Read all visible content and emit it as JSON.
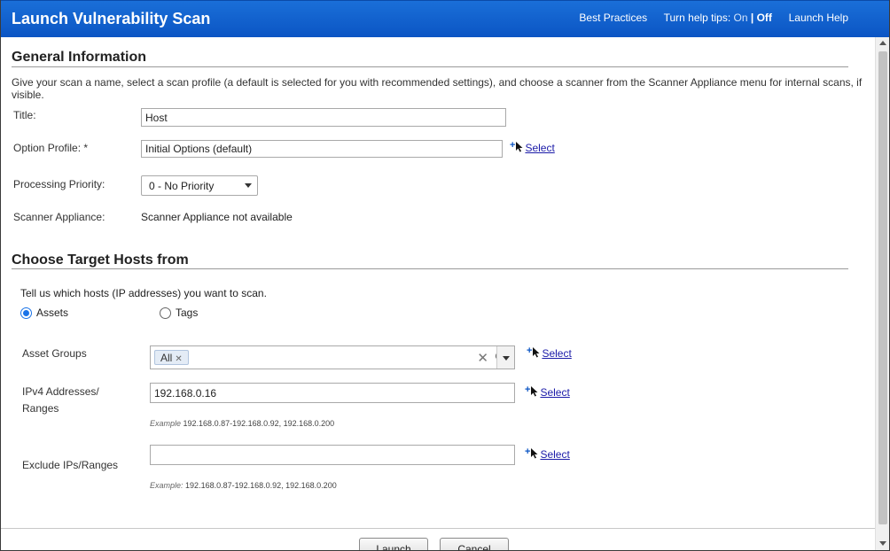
{
  "header": {
    "title": "Launch Vulnerability Scan",
    "best_practices": "Best Practices",
    "help_tips_label": "Turn help tips:",
    "help_tips_on": "On",
    "help_tips_sep": "|",
    "help_tips_off": "Off",
    "launch_help": "Launch Help"
  },
  "general": {
    "section_title": "General Information",
    "description": "Give your scan a name, select a scan profile (a default is selected for you with recommended settings), and choose a scanner from the Scanner Appliance menu for internal scans, if visible.",
    "title_label": "Title:",
    "title_value": "Host",
    "option_profile_label": "Option Profile: *",
    "option_profile_value": "Initial Options (default)",
    "option_profile_select": "Select",
    "priority_label": "Processing Priority:",
    "priority_value": "0 - No Priority",
    "scanner_label": "Scanner Appliance:",
    "scanner_value": "Scanner Appliance not available"
  },
  "targets": {
    "section_title": "Choose Target Hosts from",
    "instruction": "Tell us which hosts (IP addresses) you want to scan.",
    "radio_assets": "Assets",
    "radio_tags": "Tags",
    "asset_groups_label": "Asset Groups",
    "asset_groups_chip": "All",
    "asset_groups_select": "Select",
    "ipv4_label_line1": "IPv4 Addresses/",
    "ipv4_label_line2": "Ranges",
    "ipv4_value": "192.168.0.16",
    "ipv4_select": "Select",
    "ipv4_example_label": "Example",
    "ipv4_example_value": "192.168.0.87-192.168.0.92, 192.168.0.200",
    "exclude_label": "Exclude IPs/Ranges",
    "exclude_value": "",
    "exclude_select": "Select",
    "exclude_example_label": "Example:",
    "exclude_example_value": "192.168.0.87-192.168.0.92, 192.168.0.200"
  },
  "footer": {
    "launch_label": "Launch",
    "cancel_label": "Cancel"
  },
  "icons": {
    "select_plus": "plus-icon",
    "select_cursor": "cursor-icon",
    "clear": "close-icon",
    "refresh": "refresh-icon",
    "dropdown": "chevron-down-icon"
  },
  "colors": {
    "header_bg": "#0b55c4",
    "link": "#1a1aa8",
    "radio_accent": "#1a73e8"
  }
}
